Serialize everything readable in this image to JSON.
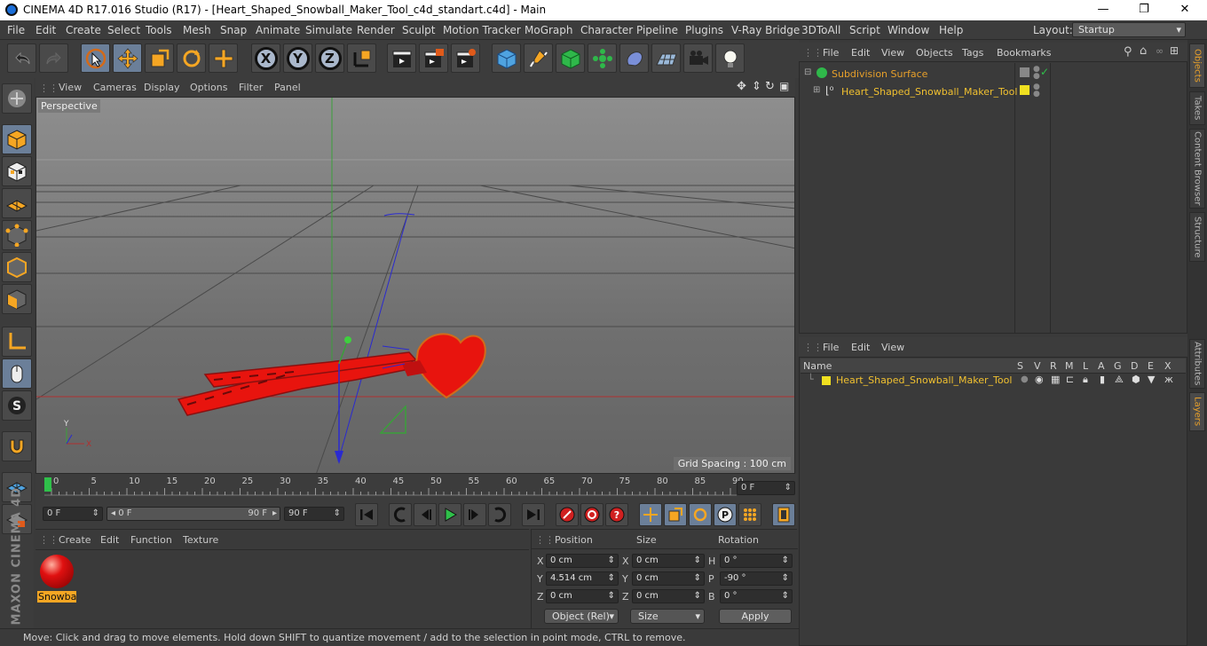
{
  "window": {
    "title": "CINEMA 4D R17.016 Studio (R17) - [Heart_Shaped_Snowball_Maker_Tool_c4d_standart.c4d] - Main",
    "minimize": "—",
    "maximize": "❐",
    "close": "✕"
  },
  "menu": [
    "File",
    "Edit",
    "Create",
    "Select",
    "Tools",
    "Mesh",
    "Snap",
    "Animate",
    "Simulate",
    "Render",
    "Sculpt",
    "Motion Tracker",
    "MoGraph",
    "Character",
    "Pipeline",
    "Plugins",
    "V-Ray Bridge",
    "3DToAll",
    "Script",
    "Window",
    "Help"
  ],
  "layout": {
    "label": "Layout:",
    "value": "Startup"
  },
  "toolbar": {
    "x": "X",
    "y": "Y",
    "z": "Z"
  },
  "viewport": {
    "menu": [
      "View",
      "Cameras",
      "Display",
      "Options",
      "Filter",
      "Panel"
    ],
    "camera_label": "Perspective",
    "grid_spacing": "Grid Spacing : 100 cm",
    "axis_y": "Y",
    "axis_x": "X"
  },
  "timeline": {
    "ticks": [
      "0",
      "5",
      "10",
      "15",
      "20",
      "25",
      "30",
      "35",
      "40",
      "45",
      "50",
      "55",
      "60",
      "65",
      "70",
      "75",
      "80",
      "85",
      "90"
    ],
    "current_frame": "0 F",
    "start_frame": "0 F",
    "range_start": "0 F",
    "range_end": "90 F",
    "end_frame": "90 F"
  },
  "materials": {
    "menu": [
      "Create",
      "Edit",
      "Function",
      "Texture"
    ],
    "items": [
      {
        "name": "Snowba"
      }
    ]
  },
  "coordinates": {
    "headers": {
      "position": "Position",
      "size": "Size",
      "rotation": "Rotation"
    },
    "rows": [
      {
        "axis": "X",
        "pos": "0 cm",
        "size_axis": "X",
        "size": "0 cm",
        "rot_axis": "H",
        "rot": "0 °"
      },
      {
        "axis": "Y",
        "pos": "4.514 cm",
        "size_axis": "Y",
        "size": "0 cm",
        "rot_axis": "P",
        "rot": "-90 °"
      },
      {
        "axis": "Z",
        "pos": "0 cm",
        "size_axis": "Z",
        "size": "0 cm",
        "rot_axis": "B",
        "rot": "0 °"
      }
    ],
    "mode": "Object (Rel)",
    "size_mode": "Size",
    "apply": "Apply"
  },
  "status": "Move: Click and drag to move elements. Hold down SHIFT to quantize movement / add to the selection in point mode, CTRL to remove.",
  "object_manager": {
    "menu": [
      "File",
      "Edit",
      "View",
      "Objects",
      "Tags",
      "Bookmarks"
    ],
    "objects": [
      {
        "name": "Subdivision Surface"
      },
      {
        "name": "Heart_Shaped_Snowball_Maker_Tool"
      }
    ]
  },
  "layer_manager": {
    "menu": [
      "File",
      "Edit",
      "View"
    ],
    "columns": [
      "Name",
      "S",
      "V",
      "R",
      "M",
      "L",
      "A",
      "G",
      "D",
      "E",
      "X"
    ],
    "layers": [
      {
        "name": "Heart_Shaped_Snowball_Maker_Tool"
      }
    ]
  },
  "right_tabs": [
    "Objects",
    "Takes",
    "Content Browser",
    "Structure",
    "Attributes",
    "Layers"
  ],
  "brand": "MAXON CINEMA 4D",
  "colors": {
    "accent": "#e8a02a",
    "selected_text": "#f0c030",
    "tool_selected": "#6b7f99",
    "object_red": "#e8140e"
  }
}
